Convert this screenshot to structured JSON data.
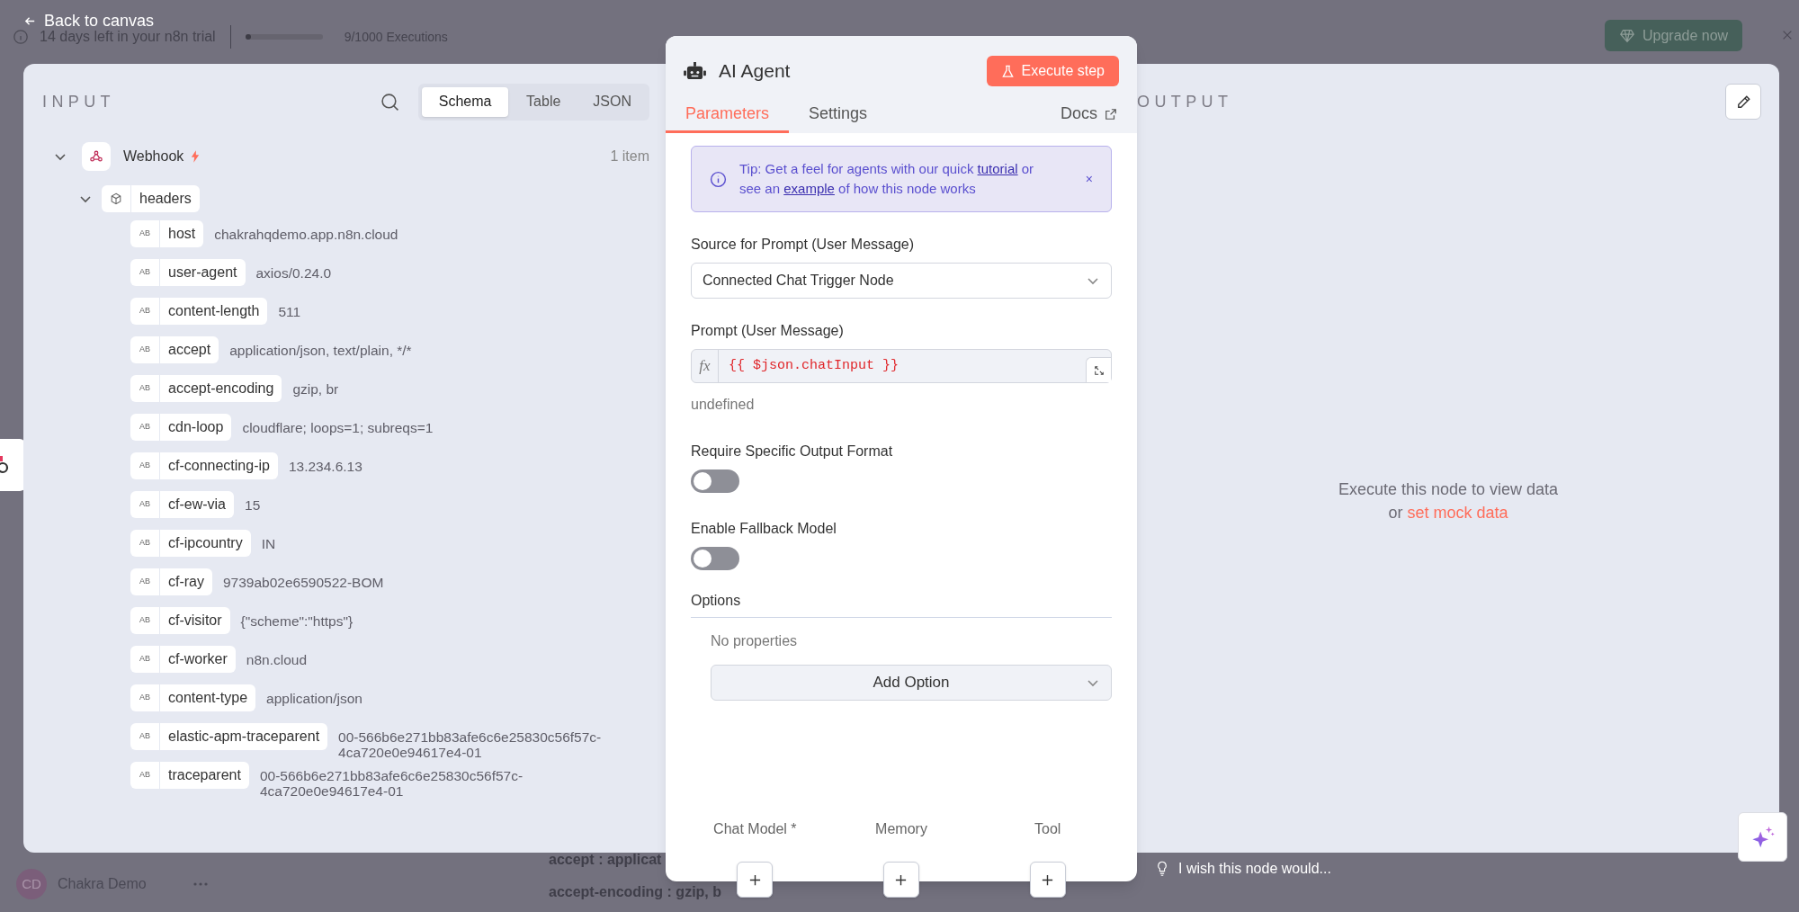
{
  "trial_banner": {
    "message": "14 days left in your n8n trial",
    "usage": {
      "level": 0.01,
      "reading": "9/1000 Executions"
    },
    "upgrade_button": "Upgrade now"
  },
  "back_link": "Back to canvas",
  "input_panel": {
    "title": "INPUT",
    "view_tabs": [
      {
        "label": "Schema",
        "selected": true
      },
      {
        "label": "Table",
        "selected": false
      },
      {
        "label": "JSON",
        "selected": false
      }
    ],
    "tree": [
      {
        "kind": "node",
        "label": "Webhook",
        "count": "1 item",
        "expanded": true,
        "children": [
          {
            "kind": "object",
            "label": "headers",
            "expanded": true,
            "children": [
              {
                "kind": "string",
                "type_badge": "AB",
                "label": "host",
                "value": "chakrahqdemo.app.n8n.cloud"
              },
              {
                "kind": "string",
                "type_badge": "AB",
                "label": "user-agent",
                "value": "axios/0.24.0"
              },
              {
                "kind": "string",
                "type_badge": "AB",
                "label": "content-length",
                "value": "511"
              },
              {
                "kind": "string",
                "type_badge": "AB",
                "label": "accept",
                "value": "application/json, text/plain, */*"
              },
              {
                "kind": "string",
                "type_badge": "AB",
                "label": "accept-encoding",
                "value": "gzip, br"
              },
              {
                "kind": "string",
                "type_badge": "AB",
                "label": "cdn-loop",
                "value": "cloudflare; loops=1; subreqs=1"
              },
              {
                "kind": "string",
                "type_badge": "AB",
                "label": "cf-connecting-ip",
                "value": "13.234.6.13"
              },
              {
                "kind": "string",
                "type_badge": "AB",
                "label": "cf-ew-via",
                "value": "15"
              },
              {
                "kind": "string",
                "type_badge": "AB",
                "label": "cf-ipcountry",
                "value": "IN"
              },
              {
                "kind": "string",
                "type_badge": "AB",
                "label": "cf-ray",
                "value": "9739ab02e6590522-BOM"
              },
              {
                "kind": "string",
                "type_badge": "AB",
                "label": "cf-visitor",
                "value": "{\"scheme\":\"https\"}"
              },
              {
                "kind": "string",
                "type_badge": "AB",
                "label": "cf-worker",
                "value": "n8n.cloud"
              },
              {
                "kind": "string",
                "type_badge": "AB",
                "label": "content-type",
                "value": "application/json"
              },
              {
                "kind": "string",
                "type_badge": "AB",
                "label": "elastic-apm-traceparent",
                "value": "00-566b6e271bb83afe6c6e25830c56f57c-4ca720e0e94617e4-01"
              },
              {
                "kind": "string",
                "type_badge": "AB",
                "label": "traceparent",
                "value": "00-566b6e271bb83afe6c6e25830c56f57c-4ca720e0e94617e4-01"
              }
            ]
          }
        ]
      }
    ]
  },
  "node_panel": {
    "title": "AI Agent",
    "execute_button": "Execute step",
    "tabs": [
      {
        "label": "Parameters",
        "selected": true
      },
      {
        "label": "Settings",
        "selected": false
      }
    ],
    "docs_link": "Docs",
    "tip": {
      "parts": [
        {
          "kind": "text",
          "text": "Tip: Get a feel for agents with our quick "
        },
        {
          "kind": "link",
          "text": "tutorial"
        },
        {
          "kind": "text",
          "text": " or see an "
        },
        {
          "kind": "link",
          "text": "example"
        },
        {
          "kind": "text",
          "text": " of how this node works"
        }
      ],
      "close": "×"
    },
    "fields": [
      {
        "kind": "select",
        "label": "Source for Prompt (User Message)",
        "value": "Connected Chat Trigger Node"
      },
      {
        "kind": "expression",
        "label": "Prompt (User Message)",
        "prefix": "fx",
        "value": "{{ $json.chatInput }}",
        "hint": "undefined"
      },
      {
        "kind": "toggle",
        "label": "Require Specific Output Format",
        "on": false
      },
      {
        "kind": "toggle",
        "label": "Enable Fallback Model",
        "on": false
      }
    ],
    "options": {
      "title": "Options",
      "empty_text": "No properties",
      "add_button": "Add Option"
    },
    "connectors": [
      {
        "label": "Chat Model *"
      },
      {
        "label": "Memory"
      },
      {
        "label": "Tool"
      }
    ]
  },
  "output_panel": {
    "title": "OUTPUT",
    "empty_message": "Execute this node to view data",
    "mock_prefix": "or",
    "mock_link": "set mock data"
  },
  "footer": {
    "user": {
      "initials": "CD",
      "name": "Chakra Demo"
    },
    "feedback_placeholder": "I wish this node would..."
  },
  "background_fragments": [
    "accept : applicat",
    "accept-encoding : gzip, b"
  ]
}
